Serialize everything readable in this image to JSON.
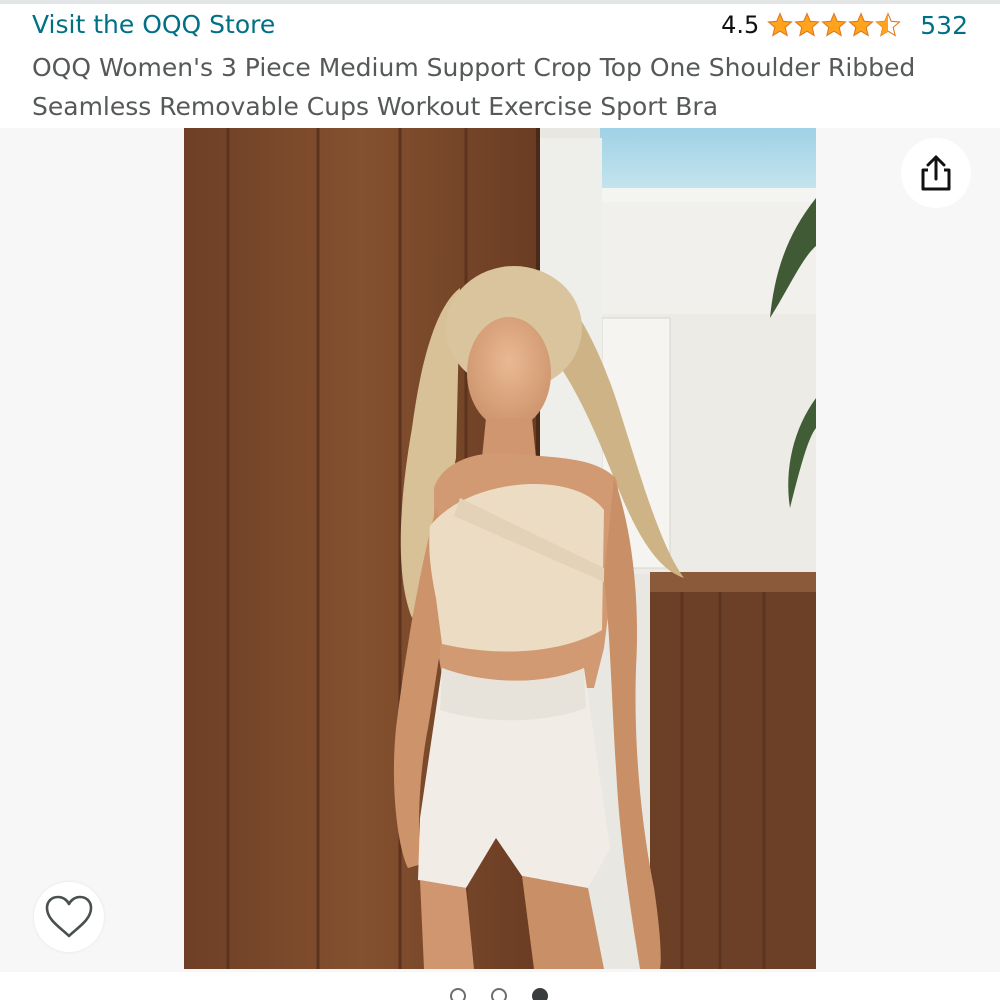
{
  "store": {
    "link_text": "Visit the OQQ Store"
  },
  "rating": {
    "value": "4.5",
    "stars": 4.5,
    "count": "532",
    "star_color": "#ffa41c"
  },
  "product": {
    "title": "OQQ Women's 3 Piece Medium Support Crop Top One Shoulder Ribbed Seamless Removable Cups Workout Exercise Sport Bra"
  },
  "actions": {
    "share_icon": "share-icon",
    "wishlist_icon": "heart-icon"
  },
  "carousel": {
    "total": 3,
    "active_index": 2
  },
  "colors": {
    "link": "#007185",
    "text": "#565959",
    "gallery_bg": "#f7f7f7"
  }
}
